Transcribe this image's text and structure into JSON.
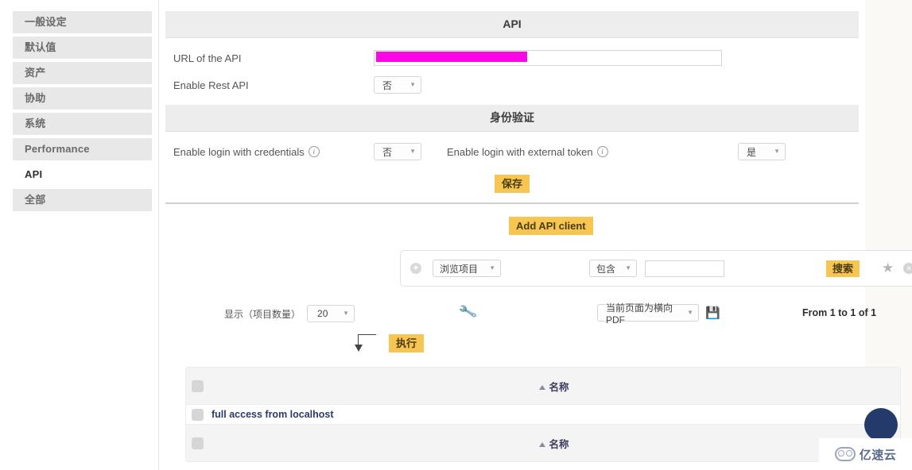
{
  "sidebar": {
    "items": [
      {
        "label": "一般设定",
        "active": false
      },
      {
        "label": "默认值",
        "active": false
      },
      {
        "label": "资产",
        "active": false
      },
      {
        "label": "协助",
        "active": false
      },
      {
        "label": "系统",
        "active": false
      },
      {
        "label": "Performance",
        "active": false
      },
      {
        "label": "API",
        "active": true
      },
      {
        "label": "全部",
        "active": false
      }
    ]
  },
  "api_section": {
    "title": "API",
    "url_label": "URL of the API",
    "url_value": "",
    "redacted": true,
    "enable_rest_label": "Enable Rest API",
    "enable_rest_value": "否"
  },
  "auth_section": {
    "title": "身份验证",
    "credentials_label": "Enable login with credentials",
    "credentials_value": "否",
    "token_label": "Enable login with external token",
    "token_value": "是",
    "save_label": "保存",
    "info_icon": "info-icon"
  },
  "add_client": {
    "label": "Add API client"
  },
  "search": {
    "add_icon": "plus-icon",
    "scope_value": "浏览项目",
    "operator_value": "包含",
    "query_value": "",
    "search_label": "搜索",
    "star_icon": "star-icon",
    "clear_icon": "close-icon"
  },
  "options": {
    "show_label": "显示（项目数量）",
    "page_size": "20",
    "settings_icon": "wrench-icon",
    "export_value": "当前页面为横向PDF",
    "save_icon": "floppy-disk-icon",
    "range_text": "From 1 to 1 of 1"
  },
  "actions": {
    "arrow_icon": "arrow-down-left-icon",
    "execute_label": "执行"
  },
  "table": {
    "header": {
      "sort_icon": "sort-ascending-icon",
      "name_column": "名称"
    },
    "rows": [
      {
        "name": "full access from localhost"
      }
    ],
    "footer": {
      "sort_icon": "sort-ascending-icon",
      "name_column": "名称"
    }
  },
  "watermark": {
    "text": "亿速云",
    "logo_icon": "cloud-logo-icon"
  },
  "colors": {
    "accent_amber": "#f7c552",
    "redaction_magenta": "#fb07e3",
    "link_navy": "#2b3a6b",
    "chat_navy": "#243a6b"
  }
}
